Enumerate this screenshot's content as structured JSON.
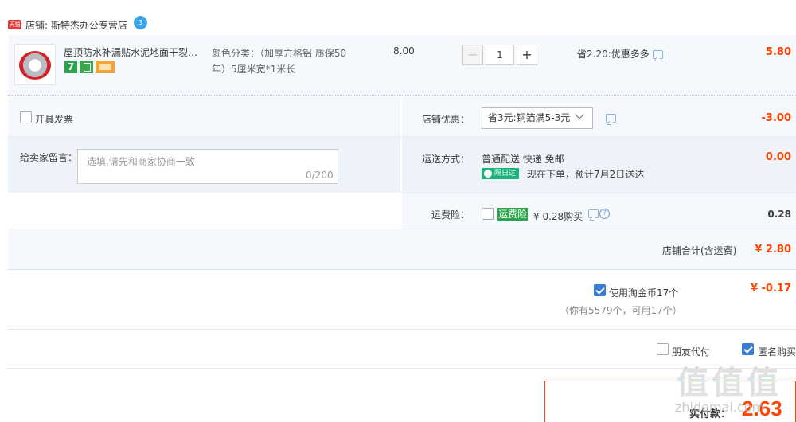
{
  "shop": {
    "badge": "天猫",
    "name": "店铺: 斯特杰办公专营店",
    "ww_badge": "3"
  },
  "item": {
    "title": "屋顶防水补漏贴水泥地面干裂堵漏胶带",
    "sku_line1": "颜色分类：（加厚方格铝 质保50",
    "sku_line2": "年）5厘米宽*1米长",
    "unit_price": "8.00",
    "qty_minus": "−",
    "qty": "1",
    "qty_plus": "+",
    "promo": "省2.20:优惠多多",
    "total": "5.80",
    "service_7": "7"
  },
  "options": {
    "invoice_label": "开具发票",
    "message_label": "给卖家留言：",
    "message_placeholder": "选填,请先和商家协商一致",
    "message_count": "0/200",
    "coupon_label": "店铺优惠：",
    "coupon_value": "省3元:铜箔满5-3元",
    "coupon_amount": "-3.00",
    "delivery_label": "运送方式：",
    "delivery_method": "普通配送 快递 免邮",
    "delivery_badge": "隔日达",
    "delivery_note": "现在下单，预计7月2日送达",
    "delivery_amount": "0.00",
    "insurance_label": "运费险：",
    "insurance_tag": "运费险",
    "insurance_price": "¥ 0.28购买",
    "insurance_amount": "0.28"
  },
  "shop_total": {
    "label": "店铺合计(含运费)",
    "value": "¥ 2.80"
  },
  "coins": {
    "label": "使用淘金币17个",
    "sub": "（你有5579个，可用17个）",
    "value": "¥ -0.17"
  },
  "footer": {
    "friend_pay": "朋友代付",
    "anonymous": "匿名购买"
  },
  "final": {
    "label": "实付款：",
    "value": "2.63"
  },
  "watermark": {
    "main": "值值值",
    "sub": "zhidemai.com"
  }
}
